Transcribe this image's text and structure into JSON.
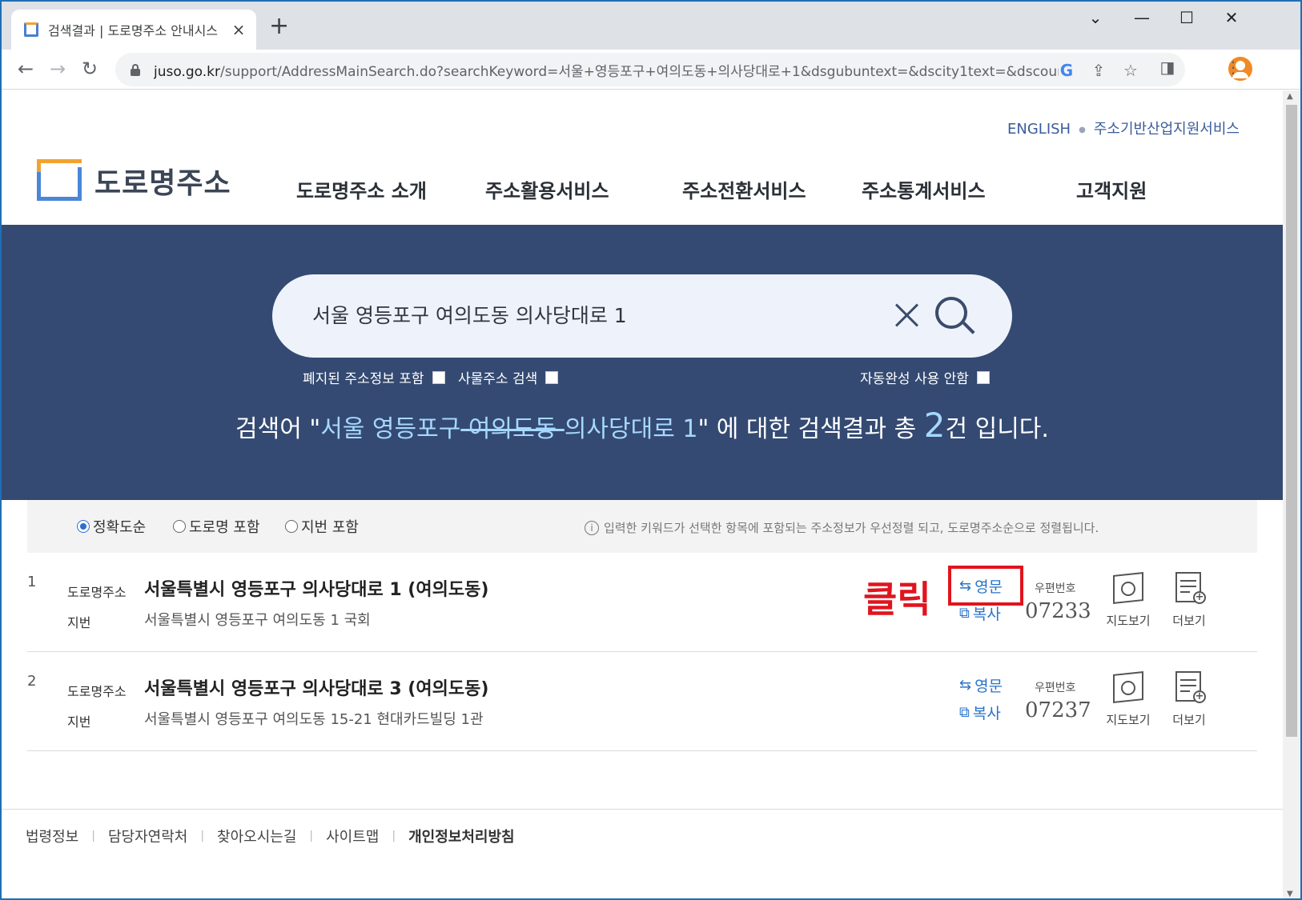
{
  "browser": {
    "tab_title": "검색결과 | 도로명주소 안내시스",
    "tab_close": "×",
    "new_tab": "+",
    "url_host": "juso.go.kr",
    "url_path": "/support/AddressMainSearch.do?searchKeyword=서울+영등포구+여의도동+의사당대로+1&dsgubuntext=&dscity1text=&dscounty1...",
    "controls": {
      "minimize": "—",
      "maximize": "☐",
      "close": "✕",
      "dropdown": "⌄"
    },
    "nav": {
      "back": "←",
      "forward": "→",
      "reload": "↻"
    },
    "icons": {
      "google": "G",
      "share": "⇪",
      "star": "☆",
      "sidepanel": "◨",
      "menu": "⋮"
    }
  },
  "site": {
    "top_links": [
      "ENGLISH",
      "주소기반산업지원서비스"
    ],
    "logo_text": "도로명주소",
    "gnb": [
      "도로명주소 소개",
      "주소활용서비스",
      "주소전환서비스",
      "주소통계서비스",
      "고객지원"
    ]
  },
  "search": {
    "value": "서울 영등포구 여의도동 의사당대로 1",
    "options": [
      "폐지된 주소정보 포함",
      "사물주소 검색",
      "자동완성 사용 안함"
    ]
  },
  "summary": {
    "prefix": "검색어 \"",
    "kw1": "서울 영등포구",
    "kw_strike": " 여의도동 ",
    "kw2": "의사당대로 1",
    "close_quote": "\"",
    "middle": " 에 대한 검색결과 총 ",
    "count": "2",
    "suffix": "건 입니다."
  },
  "sort": {
    "options": [
      "정확도순",
      "도로명 포함",
      "지번 포함"
    ],
    "selected": 0,
    "info_icon": "i",
    "note": "입력한 키워드가 선택한 항목에 포함되는 주소정보가 우선정렬 되고, 도로명주소순으로 정렬됩니다."
  },
  "labels": {
    "road": "도로명주소",
    "jibun": "지번",
    "english": "영문",
    "english_icon": "⇆",
    "copy": "복사",
    "copy_icon": "⧉",
    "postal": "우편번호",
    "map": "지도보기",
    "more": "더보기",
    "more_plus": "+"
  },
  "results": [
    {
      "num": "1",
      "road": "서울특별시 영등포구 의사당대로 1 (여의도동)",
      "jibun": "서울특별시 영등포구 여의도동 1 국회",
      "postal": "07233"
    },
    {
      "num": "2",
      "road": "서울특별시 영등포구 의사당대로 3 (여의도동)",
      "jibun": "서울특별시 영등포구 여의도동 15-21 현대카드빌딩 1관",
      "postal": "07237"
    }
  ],
  "annotation": {
    "click_label": "클릭",
    "color": "#e0141e"
  },
  "footer": [
    "법령정보",
    "담당자연락처",
    "찾아오시는길",
    "사이트맵",
    "개인정보처리방침"
  ],
  "colors": {
    "hero": "#344a72",
    "accent": "#2a73c9",
    "highlight": "#a6d8ff"
  }
}
